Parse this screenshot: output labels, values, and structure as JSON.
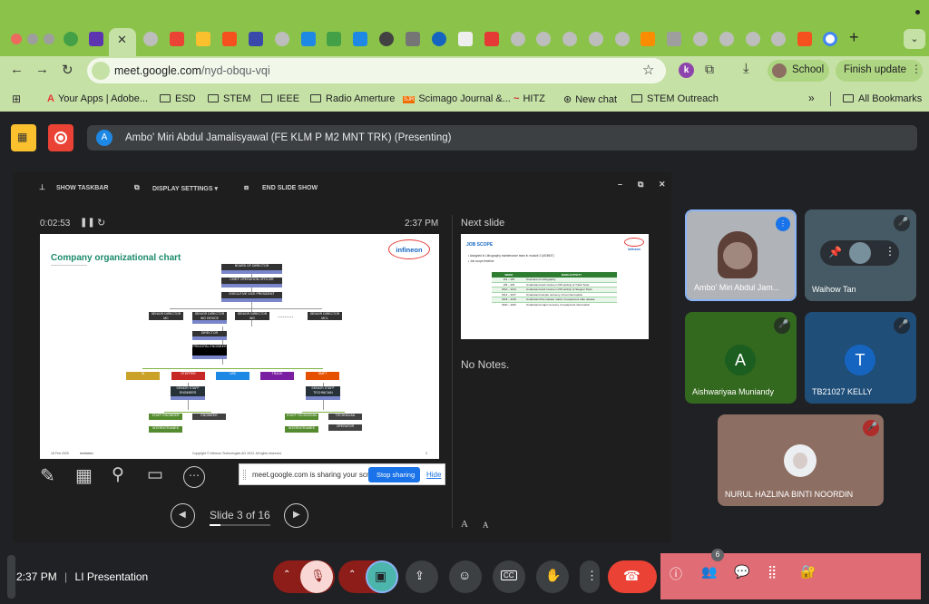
{
  "browser": {
    "address_host": "meet.google.com",
    "address_path": "/nyd-obqu-vqi",
    "profile_label": "School",
    "update_label": "Finish update",
    "extension_badge": "k"
  },
  "bookmarks": [
    {
      "label": "Your Apps | Adobe...",
      "icon": "adobe-icon"
    },
    {
      "label": "ESD",
      "icon": "folder-icon"
    },
    {
      "label": "STEM",
      "icon": "folder-icon"
    },
    {
      "label": "IEEE",
      "icon": "folder-icon"
    },
    {
      "label": "Radio Amerture",
      "icon": "folder-icon"
    },
    {
      "label": "Scimago Journal &...",
      "icon": "sjr-icon"
    },
    {
      "label": "HITZ",
      "icon": "hitz-icon"
    },
    {
      "label": "New chat",
      "icon": "chatgpt-icon"
    },
    {
      "label": "STEM Outreach",
      "icon": "folder-icon"
    },
    {
      "label": "All Bookmarks",
      "icon": "folder-icon"
    }
  ],
  "meet": {
    "presenter_avatar_letter": "A",
    "presenter_label": "Ambo' Miri Abdul Jamalisyawal (FE KLM P M2 MNT TRK) (Presenting)"
  },
  "presentation": {
    "toolbar": [
      "SHOW TASKBAR",
      "DISPLAY SETTINGS ▾",
      "END SLIDE SHOW"
    ],
    "timer": "0:02:53",
    "clock": "2:37 PM",
    "next_slide_label": "Next slide",
    "notes": "No Notes.",
    "slide_counter": "Slide 3 of 16",
    "sharing_text": "meet.google.com is sharing your screen.",
    "stop_sharing": "Stop sharing",
    "hide": "Hide",
    "font_up": "A",
    "font_down": "A",
    "slide": {
      "title": "Company organizational chart",
      "logo": "infineon",
      "boxes": {
        "board": "BOARD OF DIRECTOR",
        "ceo": "CHIEF OPERATION OFFICER",
        "evp": "EXECUTIVE VICE PRESIDENT",
        "sd1": "SENIOR DIRECTOR MC",
        "sd2": "SENIOR DIRECTOR WG DEVICE",
        "sd3": "SENIOR DIRECTOR WG",
        "sd4": "SENIOR DIRECTOR MCL",
        "ellipsis": ".........",
        "director": "DIRECTOR",
        "principal": "PRINCIPAL ENGINEER",
        "d1": "IS",
        "d2": "STEPPER",
        "d3": "LRE",
        "d4": "TRACK",
        "d5": "SMFT",
        "staff1": "SENIOR STAFF ENGINEER",
        "staff2": "SENIOR STAFF TECHNICIAN",
        "eng1": "STAFF ENGINEER",
        "eng2": "ENGINEER",
        "tech1": "STAFF TECHNICIAN",
        "tech2": "TECHNICIAN",
        "intern1": "INTERN/TRAINEE",
        "intern2": "INTERN/TRAINEE",
        "operator": "OPERATOR"
      },
      "footer_date": "18 Feb 2025",
      "footer_class": "restricted",
      "footer_copy": "Copyright © Infineon Technologies AG 2023. All rights reserved.",
      "page": "3"
    },
    "next_slide": {
      "title": "JOB SCOPE",
      "bullets": [
        "Assigned in Lithography maintenance team in module 2 (M2MNT)",
        "Job scope timeline"
      ],
      "table_header": [
        "WEEK",
        "MAIN ACTIVITY"
      ],
      "table_rows": [
        [
          "W1 – W5",
          "Overview of Lithography"
        ],
        [
          "W6 – W9",
          "Understand and involve in PM activity of Track Tools"
        ],
        [
          "W10 – W13",
          "Understand and involve in PM activity of Stepper Tools"
        ],
        [
          "W14 – W17",
          "Understand simple recovery of tool interruption"
        ],
        [
          "W18 – W19",
          "Understand the release matrix of equipment safe release"
        ],
        [
          "W20 – W22",
          "Understand major recovery of equipment interruption"
        ]
      ]
    }
  },
  "participants": [
    {
      "name": "Ambo' Miri Abdul Jam...",
      "type": "video"
    },
    {
      "name": "Waihow Tan",
      "type": "video-pinned"
    },
    {
      "name": "Aishwariyaa Muniandy",
      "letter": "A",
      "bg": "#2e7d32",
      "avatar_bg": "#1b5e20"
    },
    {
      "name": "TB21027 KELLY",
      "letter": "T",
      "bg": "#1f4e79",
      "avatar_bg": "#1565c0"
    },
    {
      "name": "NURUL HAZLINA BINTI NOORDIN",
      "bg": "#8d6e63"
    }
  ],
  "bottom": {
    "time": "2:37 PM",
    "separator": "|",
    "meeting_title": "LI Presentation",
    "people_count": "6"
  },
  "colors": {
    "chrome_green": "#8bc34a",
    "meet_bg": "#202124",
    "end_call": "#ea4335",
    "right_panel": "#e06c75"
  }
}
